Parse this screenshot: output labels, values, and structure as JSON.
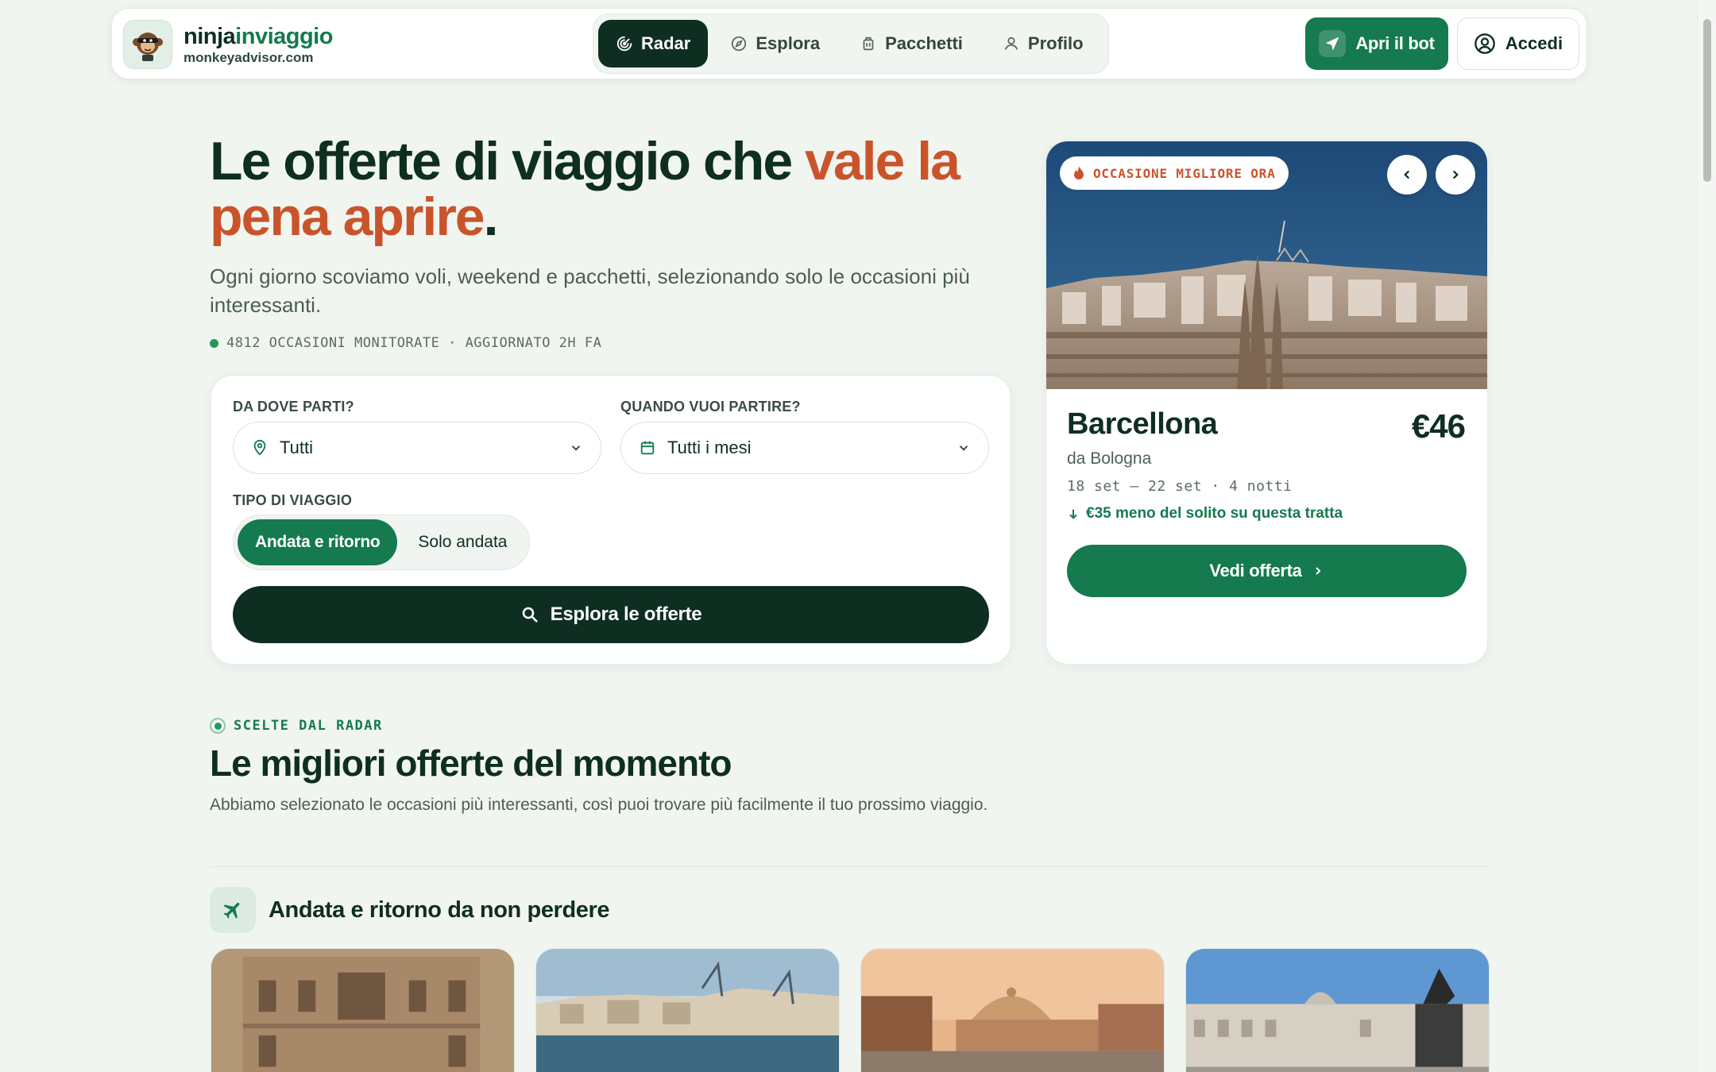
{
  "brand": {
    "name_part1": "ninja",
    "name_part2": "inviaggio",
    "domain": "monkeyadvisor.com"
  },
  "nav": {
    "items": [
      {
        "label": "Radar",
        "icon": "radar-icon",
        "active": true
      },
      {
        "label": "Esplora",
        "icon": "compass-icon",
        "active": false
      },
      {
        "label": "Pacchetti",
        "icon": "luggage-icon",
        "active": false
      },
      {
        "label": "Profilo",
        "icon": "user-icon",
        "active": false
      }
    ],
    "bot_label": "Apri il bot",
    "login_label": "Accedi"
  },
  "hero": {
    "title_part1": "Le offerte di viaggio che ",
    "title_accent": "vale la pena aprire",
    "title_end": ".",
    "subtitle": "Ogni giorno scoviamo voli, weekend e pacchetti, selezionando solo le occasioni più interessanti.",
    "meta": "4812 OCCASIONI MONITORATE · AGGIORNATO 2H FA"
  },
  "search": {
    "from_label": "DA DOVE PARTI?",
    "from_value": "Tutti",
    "when_label": "QUANDO VUOI PARTIRE?",
    "when_value": "Tutti i mesi",
    "type_label": "TIPO DI VIAGGIO",
    "type_options": [
      "Andata e ritorno",
      "Solo andata"
    ],
    "type_selected": "Andata e ritorno",
    "submit_label": "Esplora le offerte"
  },
  "featured": {
    "badge": "OCCASIONE MIGLIORE ORA",
    "city": "Barcellona",
    "price": "€46",
    "from": "da Bologna",
    "dates": "18 set – 22 set · 4 notti",
    "saving": "€35 meno del solito su questa tratta",
    "cta": "Vedi offerta"
  },
  "section": {
    "eyebrow": "SCELTE DAL RADAR",
    "title": "Le migliori offerte del momento",
    "description": "Abbiamo selezionato le occasioni più interessanti, così puoi trovare più facilmente il tuo prossimo viaggio.",
    "subsection_title": "Andata e ritorno da non perdere"
  },
  "colors": {
    "brand_dark": "#0f2e22",
    "brand_green": "#157a4e",
    "accent_orange": "#c9542c",
    "background": "#f1f5f0"
  }
}
